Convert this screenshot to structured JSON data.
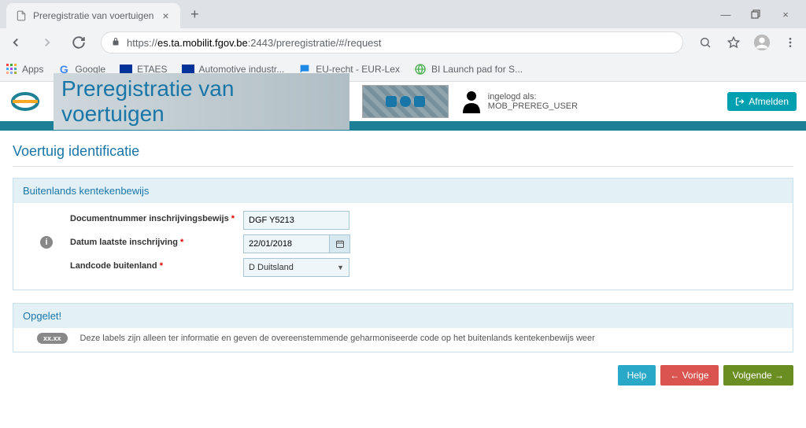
{
  "browser": {
    "tab_title": "Preregistratie van voertuigen",
    "url_host": "es.ta.mobilit.fgov.be",
    "url_scheme": "https://",
    "url_port_path": ":2443/preregistratie/#/request",
    "bookmarks": {
      "apps": "Apps",
      "google": "Google",
      "etaes": "ETAES",
      "auto_ind": "Automotive industr...",
      "eurlex": "EU-recht - EUR-Lex",
      "bis": "BI Launch pad for S..."
    }
  },
  "header": {
    "app_title": "Preregistratie van voertuigen",
    "logged_in_prefix": "ingelogd als: ",
    "logged_in_user": "MOB_PREREG_USER",
    "logout": "Afmelden"
  },
  "page": {
    "title": "Voertuig identificatie",
    "panel1_title": "Buitenlands kentekenbewijs",
    "form": {
      "docnr_label": "Documentnummer inschrijvingsbewijs",
      "docnr_value": "DGF Y5213",
      "date_label": "Datum laatste inschrijving",
      "date_value": "22/01/2018",
      "country_label": "Landcode buitenland",
      "country_value": "D Duitsland"
    },
    "panel2_title": "Opgelet!",
    "badge_xx": "xx.xx",
    "note": "Deze labels zijn alleen ter informatie en geven de overeenstemmende geharmoniseerde code op het buitenlands kentekenbewijs weer",
    "buttons": {
      "help": "Help",
      "prev": "← Vorige",
      "next": "Volgende →"
    }
  }
}
